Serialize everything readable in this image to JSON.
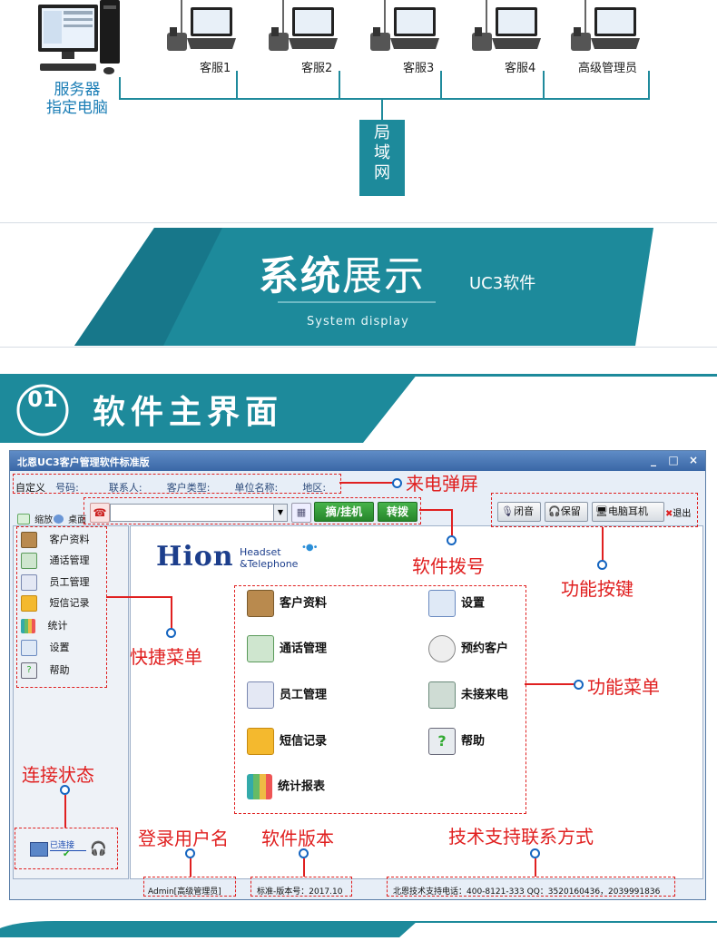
{
  "network": {
    "server_label_line1": "服务器",
    "server_label_line2": "指定电脑",
    "stations": [
      "客服1",
      "客服2",
      "客服3",
      "客服4",
      "高级管理员"
    ],
    "lan_label": "局\n域\n网"
  },
  "banner": {
    "title_bold": "系统",
    "title_normal": "展示",
    "subtitle": "UC3软件",
    "english": "System display"
  },
  "section": {
    "number": "01",
    "title": "软件主界面"
  },
  "app": {
    "title": "北恩UC3客户管理软件标准版",
    "window_controls": [
      "_",
      "□",
      "×"
    ],
    "info_fields": [
      "自定义",
      "号码:",
      "联系人:",
      "客户类型:",
      "单位名称:",
      "地区:"
    ],
    "zoom_label": "缩放",
    "desktop_label": "桌面",
    "dial_placeholder": "",
    "dial_button": "摘/挂机",
    "transfer_button": "转拨",
    "func_buttons": [
      "闭音",
      "保留",
      "电脑耳机",
      "退出"
    ],
    "sidebar": [
      "客户资料",
      "通话管理",
      "员工管理",
      "短信记录",
      "统计",
      "设置",
      "帮助"
    ],
    "logo_text": "Hion",
    "logo_sub1": "Headset",
    "logo_sub2": "&Telephone",
    "menu": [
      "客户资料",
      "设置",
      "通话管理",
      "预约客户",
      "员工管理",
      "未接来电",
      "短信记录",
      "帮助",
      "统计报表"
    ],
    "connection": "已连接",
    "status_user": "Admin[高级管理员]",
    "status_version": "标准-版本号：2017.10",
    "status_support": "北恩技术支持电话：400-8121-333   QQ：3520160436，2039991836"
  },
  "annotations": {
    "incoming": "来电弹屏",
    "dialing": "软件拨号",
    "func_keys": "功能按键",
    "quick_menu": "快捷菜单",
    "func_menu": "功能菜单",
    "connection": "连接状态",
    "login": "登录用户名",
    "version": "软件版本",
    "support": "技术支持联系方式"
  },
  "colors": {
    "teal": "#1d8a9b",
    "annotation_red": "#e02020",
    "title_blue": "#3a67a6"
  }
}
